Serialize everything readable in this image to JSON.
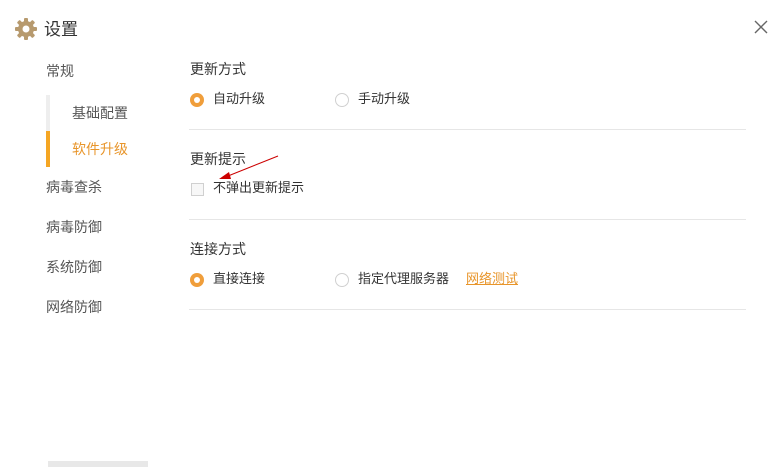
{
  "window": {
    "title": "设置",
    "icons": {
      "app": "gear-icon",
      "close": "close-icon"
    }
  },
  "sidebar": {
    "items": [
      {
        "label": "常规"
      },
      {
        "label": "病毒查杀"
      },
      {
        "label": "病毒防御"
      },
      {
        "label": "系统防御"
      },
      {
        "label": "网络防御"
      }
    ],
    "sub_items": [
      {
        "label": "基础配置",
        "active": false
      },
      {
        "label": "软件升级",
        "active": true
      }
    ]
  },
  "update_mode": {
    "title": "更新方式",
    "options": [
      {
        "label": "自动升级",
        "checked": true
      },
      {
        "label": "手动升级",
        "checked": false
      }
    ]
  },
  "update_prompt": {
    "title": "更新提示",
    "checkbox_label": "不弹出更新提示",
    "checked": false
  },
  "connection": {
    "title": "连接方式",
    "options": [
      {
        "label": "直接连接",
        "checked": true
      },
      {
        "label": "指定代理服务器",
        "checked": false
      }
    ],
    "test_link": "网络测试"
  },
  "colors": {
    "accent": "#f5a623",
    "link": "#e8952a",
    "annotation_arrow": "#cc0000"
  }
}
